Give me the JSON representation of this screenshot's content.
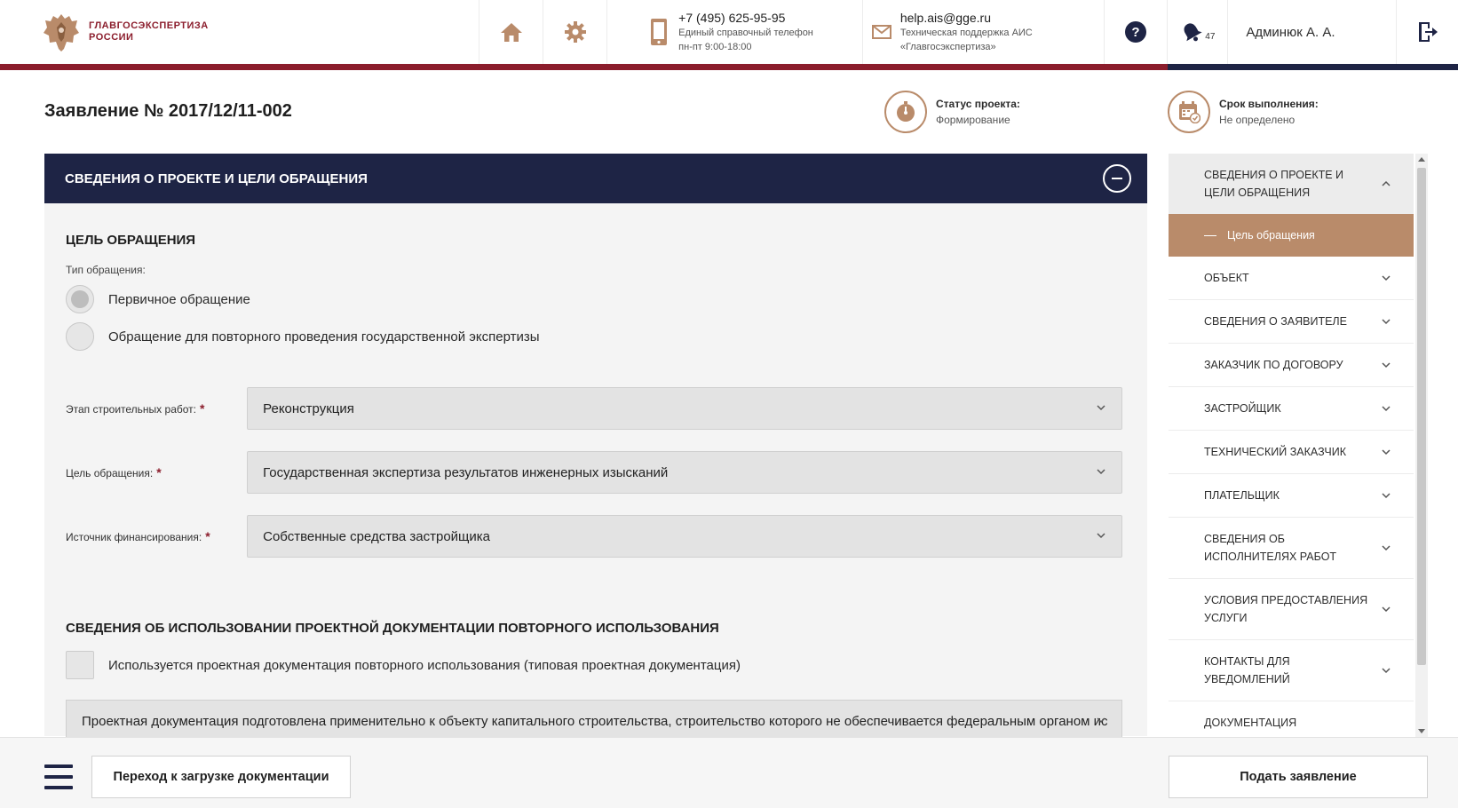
{
  "header": {
    "brand_line1": "ГЛАВГОСЭКСПЕРТИЗА",
    "brand_line2": "РОССИИ",
    "phone": "+7 (495) 625-95-95",
    "phone_sub1": "Единый справочный телефон",
    "phone_sub2": "пн-пт 9:00-18:00",
    "email": "help.ais@gge.ru",
    "email_sub1": "Техническая поддержка АИС",
    "email_sub2": "«Главгосэкспертиза»",
    "notifications_count": "47",
    "user_name": "Админюк А. А."
  },
  "title": {
    "application": "Заявление № 2017/12/11-002",
    "status_label": "Статус проекта:",
    "status_value": "Формирование",
    "deadline_label": "Срок выполнения:",
    "deadline_value": "Не определено"
  },
  "section": {
    "title": "СВЕДЕНИЯ О ПРОЕКТЕ И ЦЕЛИ ОБРАЩЕНИЯ",
    "purpose_title": "ЦЕЛЬ ОБРАЩЕНИЯ",
    "type_label": "Тип обращения:",
    "radio_primary": "Первичное обращение",
    "radio_repeat": "Обращение для повторного проведения государственной экспертизы",
    "stage_label": "Этап строительных работ:",
    "stage_value": "Реконструкция",
    "goal_label": "Цель обращения:",
    "goal_value": "Государственная экспертиза результатов инженерных изысканий",
    "finance_label": "Источник финансирования:",
    "finance_value": "Собственные средства застройщика",
    "reuse_title": "СВЕДЕНИЯ ОБ ИСПОЛЬЗОВАНИИ ПРОЕКТНОЙ ДОКУМЕНТАЦИИ ПОВТОРНОГО ИСПОЛЬЗОВАНИЯ",
    "reuse_checkbox": "Используется проектная документация повторного использования (типовая проектная документация)",
    "reuse_select": "Проектная документация подготовлена применительно к объекту капитального строительства, строительство которого не обеспечивается федеральным органом ис"
  },
  "nav": {
    "item_project_1": "СВЕДЕНИЯ О ПРОЕКТЕ И",
    "item_project_2": "ЦЕЛИ ОБРАЩЕНИЯ",
    "sub_purpose": "Цель обращения",
    "item_object": "ОБЪЕКТ",
    "item_applicant": "СВЕДЕНИЯ О ЗАЯВИТЕЛЕ",
    "item_customer": "ЗАКАЗЧИК ПО ДОГОВОРУ",
    "item_developer": "ЗАСТРОЙЩИК",
    "item_tech_customer": "ТЕХНИЧЕСКИЙ ЗАКАЗЧИК",
    "item_payer": "ПЛАТЕЛЬЩИК",
    "item_executors_1": "СВЕДЕНИЯ ОБ",
    "item_executors_2": "ИСПОЛНИТЕЛЯХ РАБОТ",
    "item_conditions_1": "УСЛОВИЯ ПРЕДОСТАВЛЕНИЯ",
    "item_conditions_2": "УСЛУГИ",
    "item_contacts_1": "КОНТАКТЫ ДЛЯ",
    "item_contacts_2": "УВЕДОМЛЕНИЙ",
    "item_docs": "ДОКУМЕНТАЦИЯ"
  },
  "footer": {
    "goto_docs": "Переход к загрузке документации",
    "submit": "Подать заявление"
  },
  "colors": {
    "navy": "#1e2445",
    "burgundy": "#8b1d2c",
    "bronze": "#b98b6a"
  }
}
